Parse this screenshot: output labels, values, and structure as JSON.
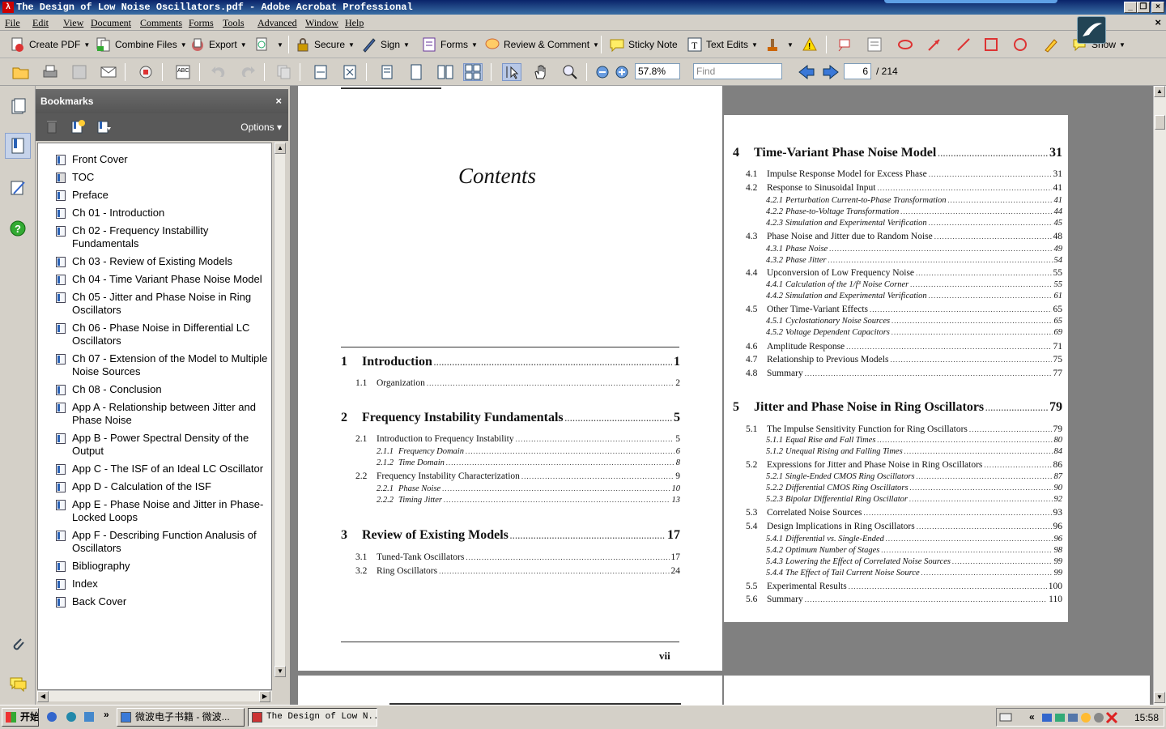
{
  "window": {
    "title": "The Design of Low Noise Oscillators.pdf - Adobe Acrobat Professional"
  },
  "menu": [
    "File",
    "Edit",
    "View",
    "Document",
    "Comments",
    "Forms",
    "Tools",
    "Advanced",
    "Window",
    "Help"
  ],
  "toolbar1": {
    "create_pdf": "Create PDF",
    "combine_files": "Combine Files",
    "export": "Export",
    "secure": "Secure",
    "sign": "Sign",
    "forms": "Forms",
    "review_comment": "Review & Comment",
    "sticky_note": "Sticky Note",
    "text_edits": "Text Edits",
    "show": "Show"
  },
  "toolbar2": {
    "zoom": "57.8%",
    "find_placeholder": "Find",
    "page_current": "6",
    "page_total": "/ 214"
  },
  "bookmarks": {
    "title": "Bookmarks",
    "close": "×",
    "options": "Options",
    "items": [
      "Front Cover",
      "TOC",
      "Preface",
      "Ch 01 - Introduction",
      "Ch 02 - Frequency Instabillity Fundamentals",
      "Ch 03 - Review of Existing Models",
      "Ch 04 - Time Variant Phase Noise Model",
      "Ch 05 - Jitter and Phase Noise in Ring Oscillators",
      "Ch 06 - Phase Noise in Differential LC Oscillators",
      "Ch 07 - Extension of the Model to Multiple Noise Sources",
      "Ch 08 - Conclusion",
      "App A - Relationship between Jitter and Phase Noise",
      "App B - Power Spectral Density of the Output",
      "App C - The ISF of an Ideal LC Oscillator",
      "App D - Calculation of the ISF",
      "App E - Phase Noise and Jitter in Phase-Locked Loops",
      "App F - Describing Function Analusis of Oscillators",
      "Bibliography",
      "Index",
      "Back Cover"
    ]
  },
  "page_left": {
    "heading": "Contents",
    "page_no": "vii",
    "entries": [
      {
        "type": "chap",
        "num": "1",
        "title": "Introduction",
        "page": "1"
      },
      {
        "type": "sec",
        "num": "1.1",
        "title": "Organization",
        "page": "2"
      },
      {
        "type": "chap",
        "num": "2",
        "title": "Frequency Instability Fundamentals",
        "page": "5"
      },
      {
        "type": "sec",
        "num": "2.1",
        "title": "Introduction to Frequency Instability",
        "page": "5"
      },
      {
        "type": "sub",
        "num": "2.1.1",
        "title": "Frequency Domain",
        "page": "6"
      },
      {
        "type": "sub",
        "num": "2.1.2",
        "title": "Time Domain",
        "page": "8"
      },
      {
        "type": "sec",
        "num": "2.2",
        "title": "Frequency Instability Characterization",
        "page": "9"
      },
      {
        "type": "sub",
        "num": "2.2.1",
        "title": "Phase Noise",
        "page": "10"
      },
      {
        "type": "sub",
        "num": "2.2.2",
        "title": "Timing Jitter",
        "page": "13"
      },
      {
        "type": "chap",
        "num": "3",
        "title": "Review of Existing Models",
        "page": "17"
      },
      {
        "type": "sec",
        "num": "3.1",
        "title": "Tuned-Tank Oscillators",
        "page": "17"
      },
      {
        "type": "sec",
        "num": "3.2",
        "title": "Ring Oscillators",
        "page": "24"
      }
    ]
  },
  "page_right": {
    "entries": [
      {
        "type": "chap",
        "num": "4",
        "title": "Time-Variant Phase Noise Model",
        "page": "31"
      },
      {
        "type": "sec",
        "num": "4.1",
        "title": "Impulse Response Model for Excess Phase",
        "page": "31"
      },
      {
        "type": "sec",
        "num": "4.2",
        "title": "Response to Sinusoidal Input",
        "page": "41"
      },
      {
        "type": "sub",
        "num": "4.2.1",
        "title": "Perturbation Current-to-Phase Transformation",
        "page": "41"
      },
      {
        "type": "sub",
        "num": "4.2.2",
        "title": "Phase-to-Voltage Transformation",
        "page": "44"
      },
      {
        "type": "sub",
        "num": "4.2.3",
        "title": "Simulation and Experimental Verification",
        "page": "45"
      },
      {
        "type": "sec",
        "num": "4.3",
        "title": "Phase Noise and Jitter due to Random Noise",
        "page": "48"
      },
      {
        "type": "sub",
        "num": "4.3.1",
        "title": "Phase Noise",
        "page": "49"
      },
      {
        "type": "sub",
        "num": "4.3.2",
        "title": "Phase Jitter",
        "page": "54"
      },
      {
        "type": "sec",
        "num": "4.4",
        "title": "Upconversion of Low Frequency Noise",
        "page": "55"
      },
      {
        "type": "sub",
        "num": "4.4.1",
        "title": "Calculation of the 1/f³ Noise Corner",
        "page": "55"
      },
      {
        "type": "sub",
        "num": "4.4.2",
        "title": "Simulation and Experimental Verification",
        "page": "61"
      },
      {
        "type": "sec",
        "num": "4.5",
        "title": "Other Time-Variant Effects",
        "page": "65"
      },
      {
        "type": "sub",
        "num": "4.5.1",
        "title": "Cyclostationary Noise Sources",
        "page": "65"
      },
      {
        "type": "sub",
        "num": "4.5.2",
        "title": "Voltage Dependent Capacitors",
        "page": "69"
      },
      {
        "type": "sec",
        "num": "4.6",
        "title": "Amplitude Response",
        "page": "71"
      },
      {
        "type": "sec",
        "num": "4.7",
        "title": "Relationship to Previous Models",
        "page": "75"
      },
      {
        "type": "sec",
        "num": "4.8",
        "title": "Summary",
        "page": "77"
      },
      {
        "type": "chap",
        "num": "5",
        "title": "Jitter and Phase Noise in Ring Oscillators",
        "page": "79"
      },
      {
        "type": "sec",
        "num": "5.1",
        "title": "The Impulse Sensitivity Function for Ring Oscillators",
        "page": "79"
      },
      {
        "type": "sub",
        "num": "5.1.1",
        "title": "Equal Rise and Fall Times",
        "page": "80"
      },
      {
        "type": "sub",
        "num": "5.1.2",
        "title": "Unequal Rising and Falling Times",
        "page": "84"
      },
      {
        "type": "sec",
        "num": "5.2",
        "title": "Expressions for Jitter and Phase Noise in Ring Oscillators",
        "page": "86"
      },
      {
        "type": "sub",
        "num": "5.2.1",
        "title": "Single-Ended CMOS Ring Oscillators",
        "page": "87"
      },
      {
        "type": "sub",
        "num": "5.2.2",
        "title": "Differential CMOS Ring Oscillators",
        "page": "90"
      },
      {
        "type": "sub",
        "num": "5.2.3",
        "title": "Bipolar Differential Ring Oscillator",
        "page": "92"
      },
      {
        "type": "sec",
        "num": "5.3",
        "title": "Correlated Noise Sources",
        "page": "93"
      },
      {
        "type": "sec",
        "num": "5.4",
        "title": "Design Implications in Ring Oscillators",
        "page": "96"
      },
      {
        "type": "sub",
        "num": "5.4.1",
        "title": "Differential vs. Single-Ended",
        "page": "96"
      },
      {
        "type": "sub",
        "num": "5.4.2",
        "title": "Optimum Number of Stages",
        "page": "98"
      },
      {
        "type": "sub",
        "num": "5.4.3",
        "title": "Lowering the Effect of Correlated Noise Sources",
        "page": "99"
      },
      {
        "type": "sub",
        "num": "5.4.4",
        "title": "The Effect of Tail Current Noise Source",
        "page": "99"
      },
      {
        "type": "sec",
        "num": "5.5",
        "title": "Experimental Results",
        "page": "100"
      },
      {
        "type": "sec",
        "num": "5.6",
        "title": "Summary",
        "page": "110"
      }
    ]
  },
  "taskbar": {
    "start": "开始",
    "tasks": [
      "微波电子书籍 - 微波...",
      "The Design of Low N..."
    ],
    "clock": "15:58"
  }
}
